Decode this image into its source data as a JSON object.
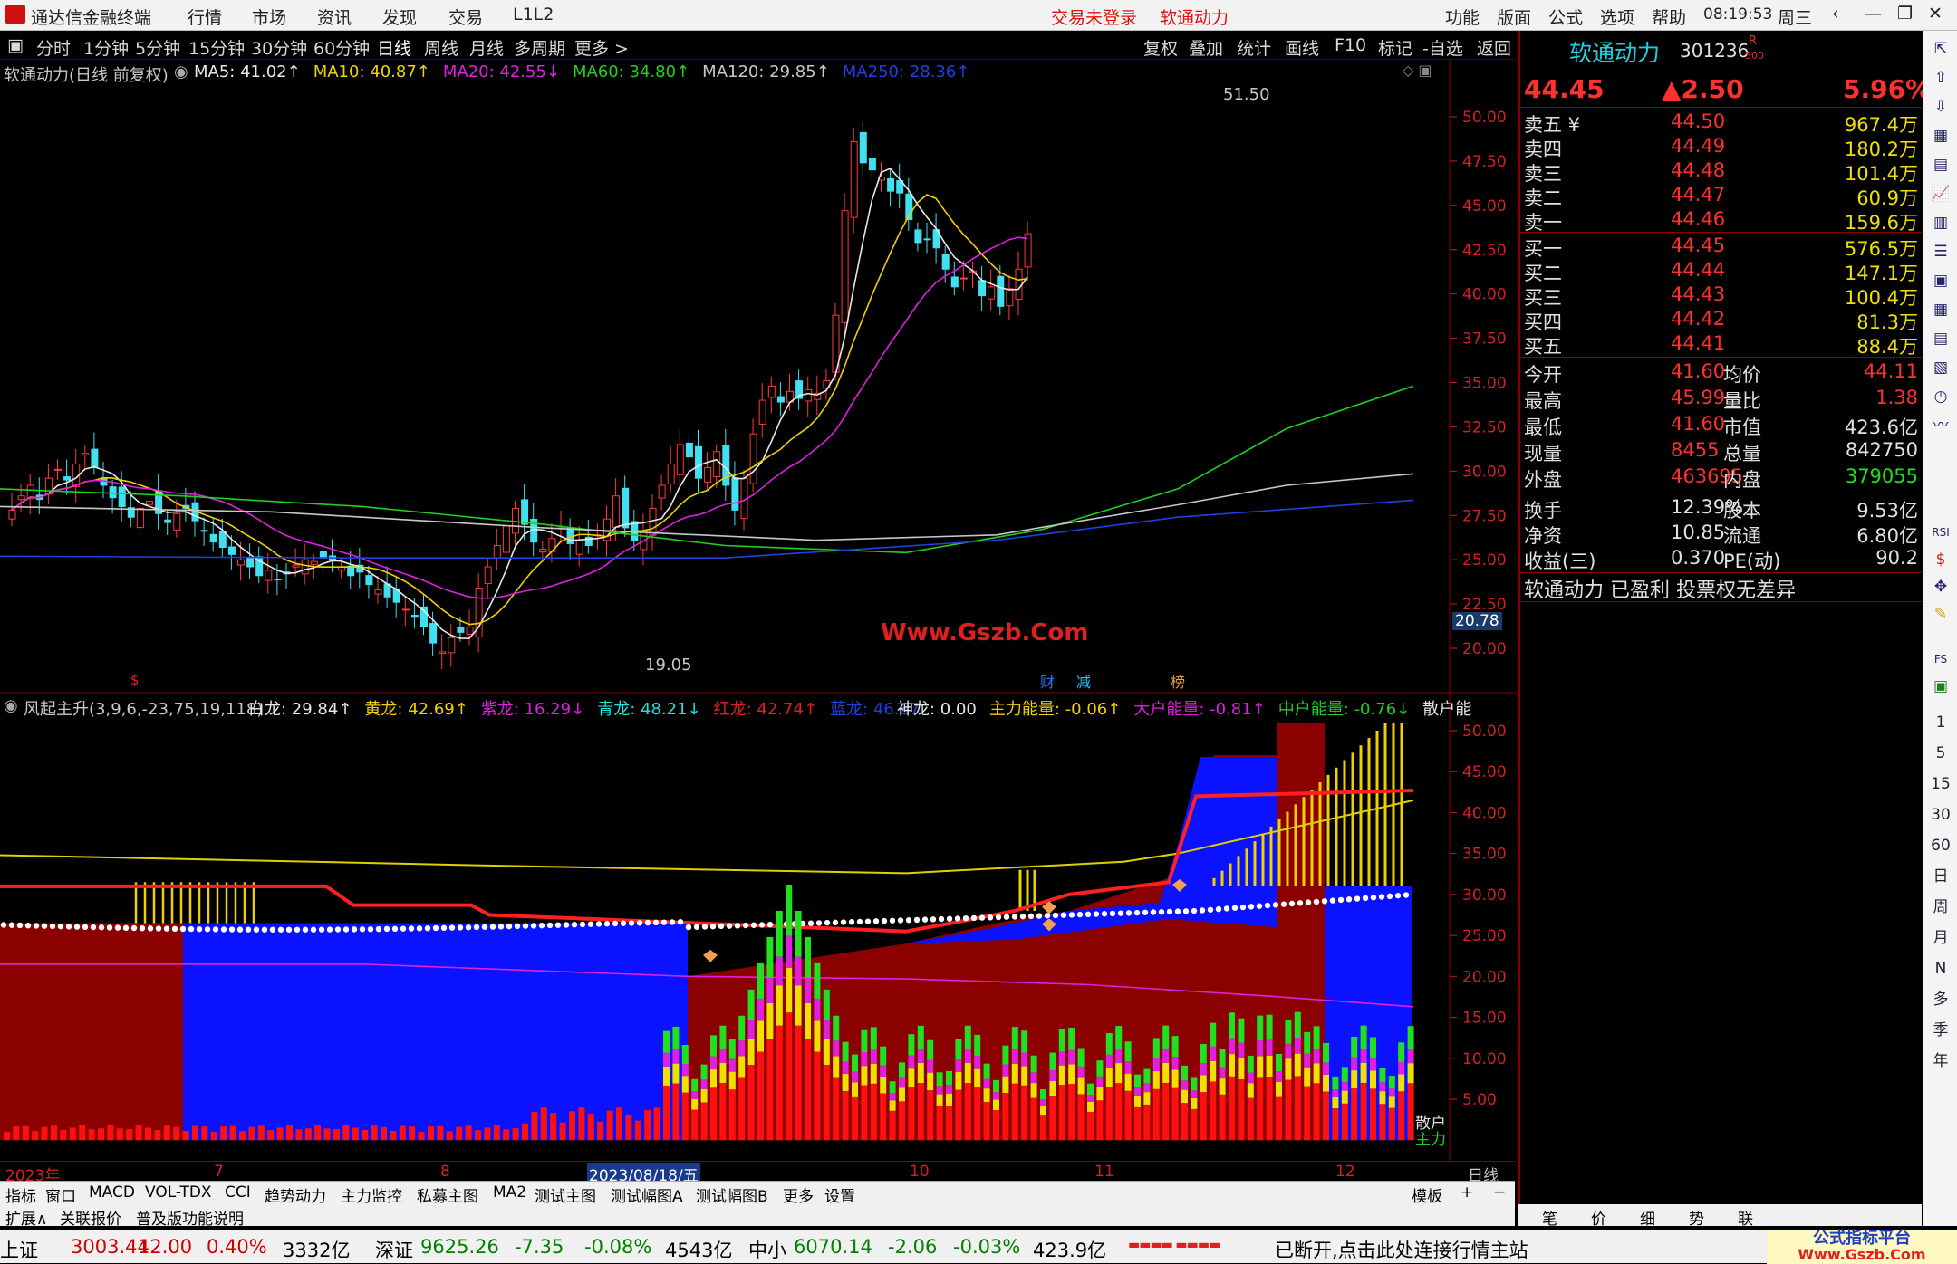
{
  "titlebar": {
    "app_name": "通达信金融终端",
    "menu": [
      "行情",
      "市场",
      "资讯",
      "发现",
      "交易",
      "L1L2"
    ],
    "status_login": "交易未登录",
    "stock_name": "软通动力",
    "right_menu": [
      "功能",
      "版面",
      "公式",
      "选项",
      "帮助"
    ],
    "time": "08:19:53",
    "weekday": "周三"
  },
  "period_toolbar": {
    "items": [
      "分时",
      "1分钟",
      "5分钟",
      "15分钟",
      "30分钟",
      "60分钟",
      "日线",
      "周线",
      "月线",
      "多周期",
      "更多 >"
    ],
    "active": "日线",
    "right_items": [
      "复权",
      "叠加",
      "统计",
      "画线",
      "F10",
      "标记",
      "-自选",
      "返回"
    ]
  },
  "main_chart": {
    "title": "软通动力(日线 前复权)",
    "ma": [
      {
        "label": "MA5: 41.02",
        "arrow": "↑",
        "color": "#e8e8e8"
      },
      {
        "label": "MA10: 40.87",
        "arrow": "↑",
        "color": "#f0d000"
      },
      {
        "label": "MA20: 42.55",
        "arrow": "↓",
        "color": "#e020e0"
      },
      {
        "label": "MA60: 34.80",
        "arrow": "↑",
        "color": "#20d020"
      },
      {
        "label": "MA120: 29.85",
        "arrow": "↑",
        "color": "#c8c8c8"
      },
      {
        "label": "MA250: 28.36",
        "arrow": "↑",
        "color": "#2040e0"
      }
    ],
    "high_label": "51.50",
    "low_label": "19.05",
    "watermark": "Www.Gszb.Com",
    "price_badge": "20.78",
    "markers": [
      "财",
      "减",
      "榜"
    ],
    "y_ticks": [
      "50.00",
      "47.50",
      "45.00",
      "42.50",
      "40.00",
      "37.50",
      "35.00",
      "32.50",
      "30.00",
      "27.50",
      "25.00",
      "22.50",
      "20.00"
    ]
  },
  "sub_chart": {
    "title": "风起主升(3,9,6,-23,75,19,118)",
    "legend": [
      {
        "label": "白龙: 29.84",
        "arrow": "↑",
        "color": "#e8e8e8"
      },
      {
        "label": "黄龙: 42.69",
        "arrow": "↑",
        "color": "#f0d000"
      },
      {
        "label": "紫龙: 16.29",
        "arrow": "↓",
        "color": "#e020e0"
      },
      {
        "label": "青龙: 48.21",
        "arrow": "↓",
        "color": "#20e0e0"
      },
      {
        "label": "红龙: 42.74",
        "arrow": "↑",
        "color": "#e02020"
      },
      {
        "label": "蓝龙: 46.87",
        "arrow": "",
        "color": "#2040e0"
      }
    ],
    "legend2": [
      {
        "label": "神龙: 0.00",
        "arrow": "",
        "color": "#e8e8e8"
      },
      {
        "label": "主力能量: -0.06",
        "arrow": "↑",
        "color": "#f0d000"
      },
      {
        "label": "大户能量: -0.81",
        "arrow": "↑",
        "color": "#e020e0"
      },
      {
        "label": "中户能量: -0.76",
        "arrow": "↓",
        "color": "#20d020"
      },
      {
        "label": "散户能",
        "arrow": "",
        "color": "#e8e8e8"
      }
    ],
    "y_ticks": [
      "50.00",
      "45.00",
      "40.00",
      "35.00",
      "30.00",
      "25.00",
      "20.00",
      "15.00",
      "10.00",
      "5.00"
    ],
    "side_label_1": "散户",
    "side_label_2": "主力"
  },
  "x_axis": {
    "labels": [
      "2023年",
      "7",
      "8",
      "2023/08/18/五",
      "10",
      "11",
      "12"
    ],
    "period": "日线"
  },
  "bottom_tabs": {
    "row1": [
      "指标",
      "窗口",
      "MACD",
      "VOL-TDX",
      "CCI",
      "趋势动力",
      "主力监控",
      "私募主图",
      "MA2",
      "测试主图",
      "测试幅图A",
      "测试幅图B",
      "更多",
      "设置"
    ],
    "row1_right": [
      "模板",
      "+",
      "−"
    ],
    "row2": [
      "扩展∧",
      "关联报价",
      "普及版功能说明"
    ]
  },
  "quote": {
    "name": "软通动力",
    "code": "301236",
    "badge": "R",
    "badge2": "500",
    "price": "44.45",
    "change": "▲2.50",
    "pct": "5.96%",
    "sells": [
      {
        "label": "卖五",
        "flag": "¥",
        "price": "44.50",
        "vol": "967.4万"
      },
      {
        "label": "卖四",
        "flag": "",
        "price": "44.49",
        "vol": "180.2万"
      },
      {
        "label": "卖三",
        "flag": "",
        "price": "44.48",
        "vol": "101.4万"
      },
      {
        "label": "卖二",
        "flag": "",
        "price": "44.47",
        "vol": "60.9万"
      },
      {
        "label": "卖一",
        "flag": "",
        "price": "44.46",
        "vol": "159.6万"
      }
    ],
    "buys": [
      {
        "label": "买一",
        "price": "44.45",
        "vol": "576.5万"
      },
      {
        "label": "买二",
        "price": "44.44",
        "vol": "147.1万"
      },
      {
        "label": "买三",
        "price": "44.43",
        "vol": "100.4万"
      },
      {
        "label": "买四",
        "price": "44.42",
        "vol": "81.3万"
      },
      {
        "label": "买五",
        "price": "44.41",
        "vol": "88.4万"
      }
    ],
    "stats1": [
      {
        "k1": "今开",
        "v1": "41.60",
        "c1": "up",
        "k2": "均价",
        "v2": "44.11",
        "c2": "up"
      },
      {
        "k1": "最高",
        "v1": "45.99",
        "c1": "up",
        "k2": "量比",
        "v2": "1.38",
        "c2": "up"
      },
      {
        "k1": "最低",
        "v1": "41.60",
        "c1": "up",
        "k2": "市值",
        "v2": "423.6亿",
        "c2": "w"
      },
      {
        "k1": "现量",
        "v1": "8455",
        "c1": "up",
        "k2": "总量",
        "v2": "842750",
        "c2": "w"
      },
      {
        "k1": "外盘",
        "v1": "463695",
        "c1": "up",
        "k2": "内盘",
        "v2": "379055",
        "c2": "dn"
      }
    ],
    "stats2": [
      {
        "k1": "换手",
        "v1": "12.39%",
        "k2": "股本",
        "v2": "9.53亿"
      },
      {
        "k1": "净资",
        "v1": "10.85",
        "k2": "流通",
        "v2": "6.80亿"
      },
      {
        "k1": "收益(三)",
        "v1": "0.370",
        "k2": "PE(动)",
        "v2": "90.2"
      }
    ],
    "note": "软通动力 已盈利 投票权无差异",
    "bottom_tabs": [
      "笔",
      "价",
      "细",
      "势",
      "联"
    ]
  },
  "sidebar": {
    "items": [
      "1",
      "5",
      "15",
      "30",
      "60",
      "日",
      "周",
      "月",
      "N",
      "多",
      "季",
      "年"
    ],
    "small": [
      "RSI",
      "FS"
    ]
  },
  "status_bar": {
    "indices": [
      {
        "name": "上证",
        "value": "3003.44",
        "chg": "12.00",
        "pct": "0.40%",
        "amt": "3332亿",
        "dir": "up"
      },
      {
        "name": "深证",
        "value": "9625.26",
        "chg": "-7.35",
        "pct": "-0.08%",
        "amt": "4543亿",
        "dir": "dn"
      },
      {
        "name": "中小",
        "value": "6070.14",
        "chg": "-2.06",
        "pct": "-0.03%",
        "amt": "423.9亿",
        "dir": "dn"
      }
    ],
    "message": "已断开,点击此处连接行情主站",
    "brand": "公式指标平台",
    "brand_url": "Www.Gszb.Com"
  }
}
